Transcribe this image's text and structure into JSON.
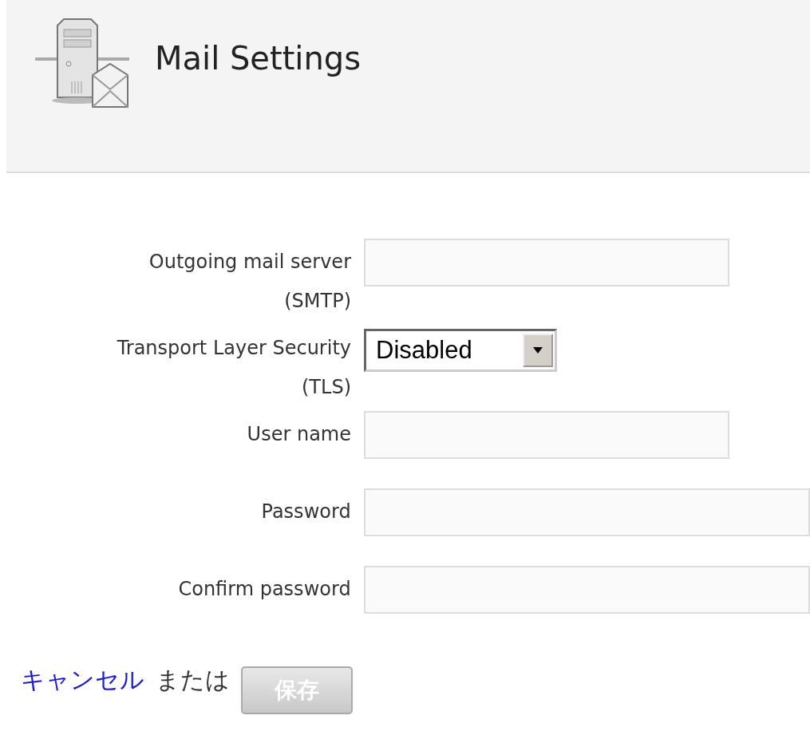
{
  "header": {
    "title": "Mail Settings"
  },
  "fields": [
    {
      "label": "Outgoing mail server (SMTP)",
      "kind": "text"
    },
    {
      "label": "Transport Layer Security (TLS)",
      "kind": "select",
      "value": "Disabled"
    },
    {
      "label": "User name",
      "kind": "text"
    },
    {
      "label": "Password",
      "kind": "password"
    },
    {
      "label": "Confirm password",
      "kind": "password"
    }
  ],
  "footer": {
    "cancel": "キャンセル",
    "or": "または",
    "save": {
      "label": "保存",
      "disabled": true
    }
  }
}
